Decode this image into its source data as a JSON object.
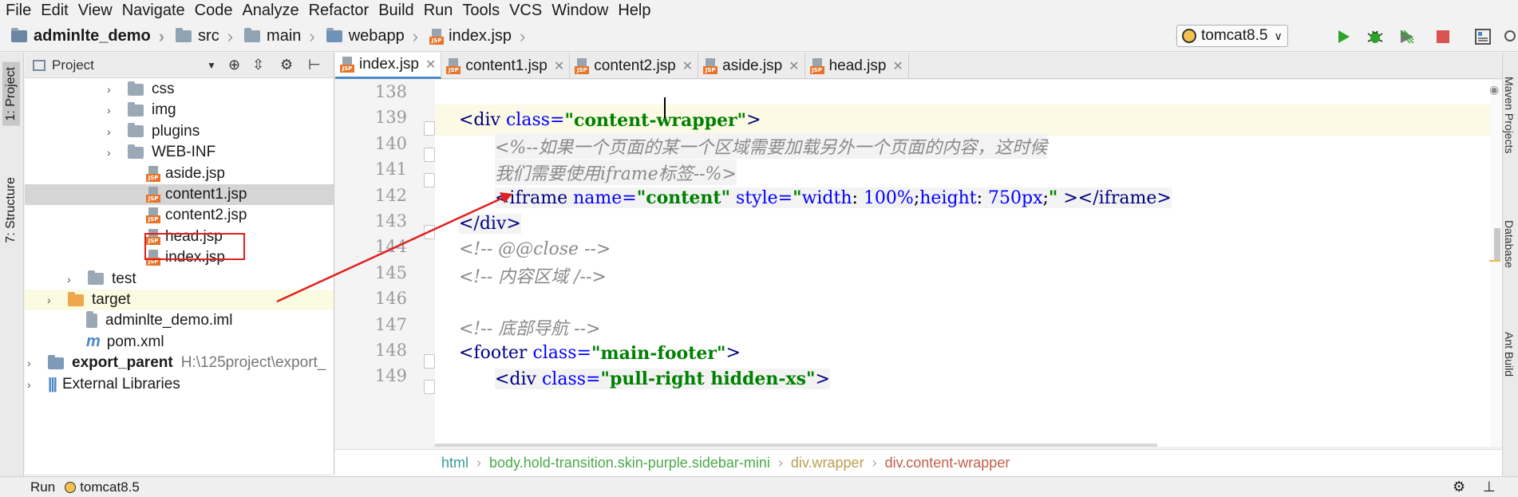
{
  "menu": [
    "File",
    "Edit",
    "View",
    "Navigate",
    "Code",
    "Analyze",
    "Refactor",
    "Build",
    "Run",
    "Tools",
    "VCS",
    "Window",
    "Help"
  ],
  "breadcrumb": [
    {
      "label": "adminlte_demo",
      "bold": true,
      "icon": "project-icon"
    },
    {
      "label": "src",
      "icon": "folder-icon"
    },
    {
      "label": "main",
      "icon": "folder-icon"
    },
    {
      "label": "webapp",
      "icon": "folder-icon"
    },
    {
      "label": "index.jsp",
      "icon": "jsp-file-icon"
    }
  ],
  "run_config": "tomcat8.5",
  "project_panel": {
    "title": "Project",
    "rows": [
      {
        "label": "css",
        "type": "folder",
        "arrow": "›",
        "indent": 135
      },
      {
        "label": "img",
        "type": "folder",
        "arrow": "›",
        "indent": 135
      },
      {
        "label": "plugins",
        "type": "folder",
        "arrow": "›",
        "indent": 135
      },
      {
        "label": "WEB-INF",
        "type": "folder",
        "arrow": "›",
        "indent": 135
      },
      {
        "label": "aside.jsp",
        "type": "jsp",
        "indent": 160
      },
      {
        "label": "content1.jsp",
        "type": "jsp",
        "indent": 160,
        "selected": true
      },
      {
        "label": "content2.jsp",
        "type": "jsp",
        "indent": 160
      },
      {
        "label": "head.jsp",
        "type": "jsp",
        "indent": 160
      },
      {
        "label": "index.jsp",
        "type": "jsp",
        "indent": 160,
        "boxed": true
      },
      {
        "label": "test",
        "type": "folder",
        "arrow": "›",
        "indent": 85
      },
      {
        "label": "target",
        "type": "folder-orange",
        "arrow": "›",
        "indent": 60,
        "highlight": true
      },
      {
        "label": "adminlte_demo.iml",
        "type": "iml",
        "indent": 85
      },
      {
        "label": "pom.xml",
        "type": "maven",
        "indent": 85
      },
      {
        "label": "export_parent",
        "type": "project",
        "arrow": "›",
        "indent": 35,
        "bold": true,
        "suffix": "H:\\125project\\export_"
      },
      {
        "label": "External Libraries",
        "type": "libs",
        "arrow": "›",
        "indent": 35
      }
    ]
  },
  "tabs": [
    "index.jsp",
    "content1.jsp",
    "content2.jsp",
    "aside.jsp",
    "head.jsp"
  ],
  "line_numbers": [
    "138",
    "139",
    "140",
    "141",
    "142",
    "143",
    "144",
    "145",
    "146",
    "147",
    "148",
    "149"
  ],
  "code": {
    "l139": [
      "<div ",
      "class=",
      "\"content-wrapper\"",
      ">"
    ],
    "l140": "<%--如果一个页面的某一个区域需要加载另外一个页面的内容，这时候",
    "l141": "我们需要使用iframe标签--%>",
    "l142": [
      "<iframe ",
      "name=",
      "\"content\"",
      " style=",
      "\"",
      "width",
      ": ",
      "100%",
      ";",
      "height",
      ": ",
      "750px",
      ";",
      "\"",
      "",
      " ></iframe>"
    ],
    "l143": "</div>",
    "l144": "<!-- @@close -->",
    "l145": "<!-- 内容区域 /-->",
    "l147": "<!-- 底部导航 -->",
    "l148": [
      "<footer ",
      "class=",
      "\"main-footer\"",
      ">"
    ],
    "l149": [
      "<div ",
      "class=",
      "\"pull-right hidden-xs\"",
      ">"
    ]
  },
  "editor_breadcrumb": [
    "html",
    "body.hold-transition.skin-purple.sidebar-mini",
    "div.wrapper",
    "div.content-wrapper"
  ],
  "left_tabs": [
    "1: Project",
    "7: Structure"
  ],
  "right_tabs": [
    "Maven Projects",
    "Database",
    "Ant Build"
  ],
  "status": {
    "run_label": "Run",
    "config": "tomcat8.5"
  },
  "colors": {
    "annotation_red": "#e02020",
    "run_green": "#2aa52a",
    "stop_red": "#d9534f"
  }
}
